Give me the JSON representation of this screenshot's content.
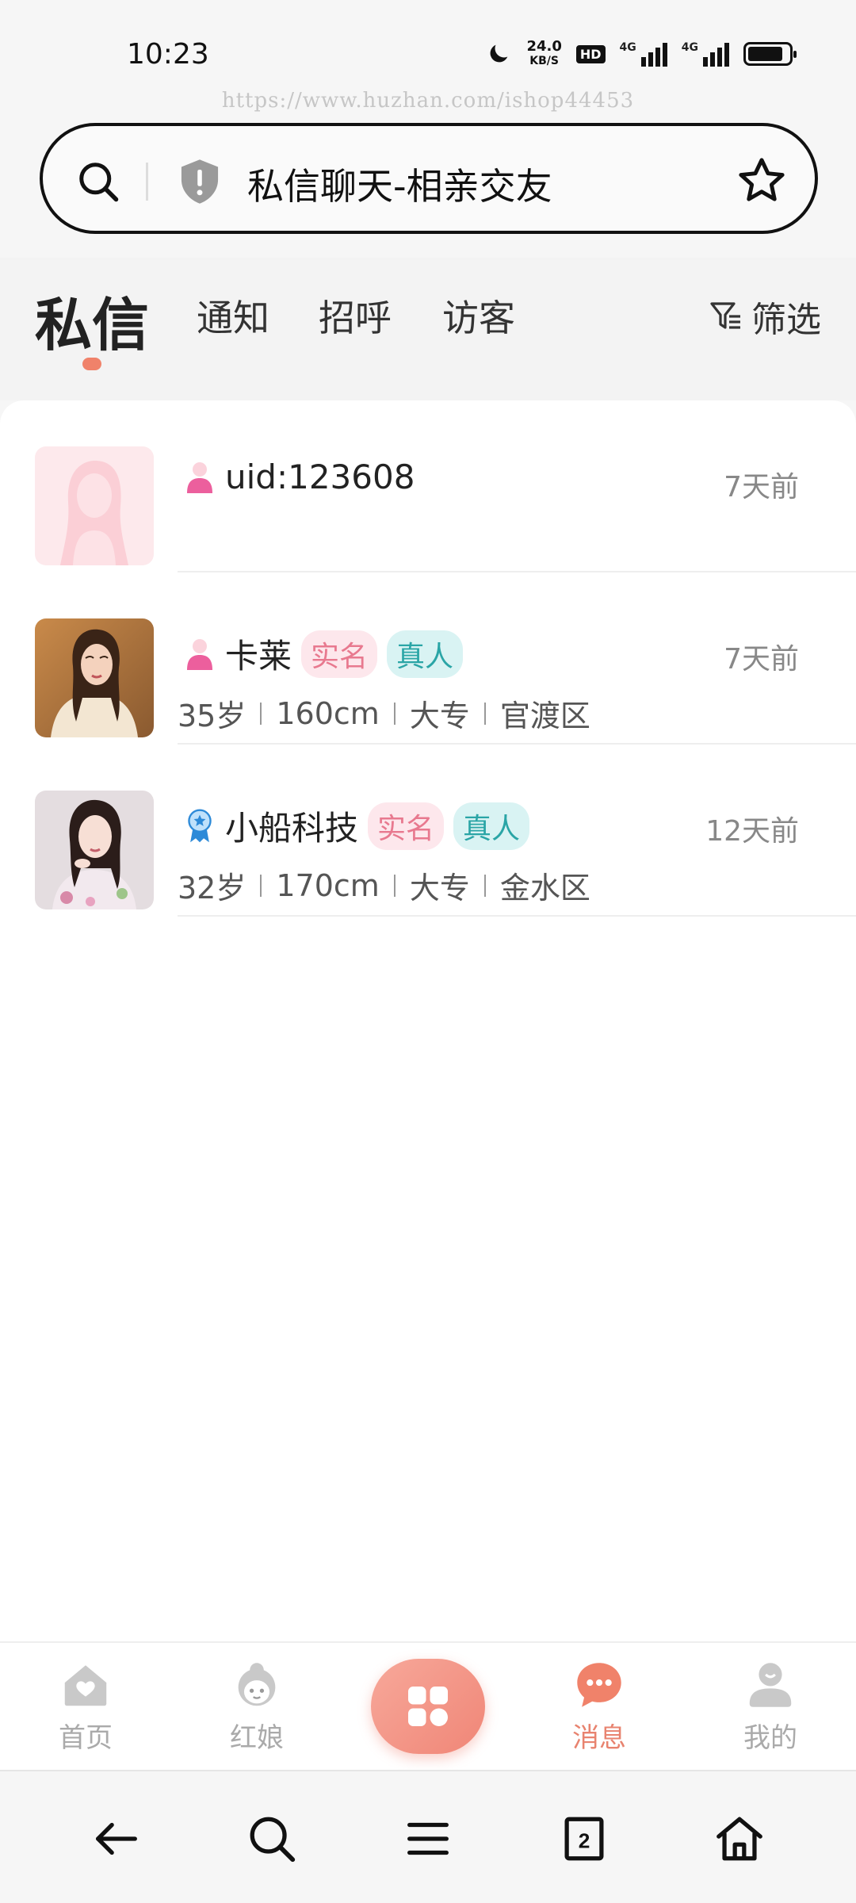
{
  "status_bar": {
    "time": "10:23",
    "speed_value": "24.0",
    "speed_unit": "KB/S",
    "hd_label": "HD",
    "net1": "4G",
    "net2": "4G"
  },
  "watermark": "https://www.huzhan.com/ishop44453",
  "address_bar": {
    "title": "私信聊天-相亲交友"
  },
  "tabs": [
    {
      "label": "私信",
      "active": true
    },
    {
      "label": "通知",
      "active": false
    },
    {
      "label": "招呼",
      "active": false
    },
    {
      "label": "访客",
      "active": false
    }
  ],
  "filter_label": "筛选",
  "conversations": [
    {
      "name": "uid:123608",
      "time": "7天前",
      "badges": [],
      "meta": []
    },
    {
      "name": "卡莱",
      "time": "7天前",
      "badges": [
        "实名",
        "真人"
      ],
      "meta": [
        "35岁",
        "160cm",
        "大专",
        "官渡区"
      ]
    },
    {
      "name": "小船科技",
      "time": "12天前",
      "badges": [
        "实名",
        "真人"
      ],
      "meta": [
        "32岁",
        "170cm",
        "大专",
        "金水区"
      ]
    }
  ],
  "bottom_nav": [
    {
      "label": "首页",
      "icon": "home-heart-icon"
    },
    {
      "label": "红娘",
      "icon": "matchmaker-icon"
    },
    {
      "label": "",
      "icon": "grid-icon"
    },
    {
      "label": "消息",
      "icon": "chat-bubble-icon",
      "active": true
    },
    {
      "label": "我的",
      "icon": "profile-icon"
    }
  ],
  "system_nav": {
    "tab_count": "2"
  },
  "colors": {
    "accent": "#f0826a",
    "badge_real": "#e8798f",
    "badge_person": "#2aa5a6"
  }
}
